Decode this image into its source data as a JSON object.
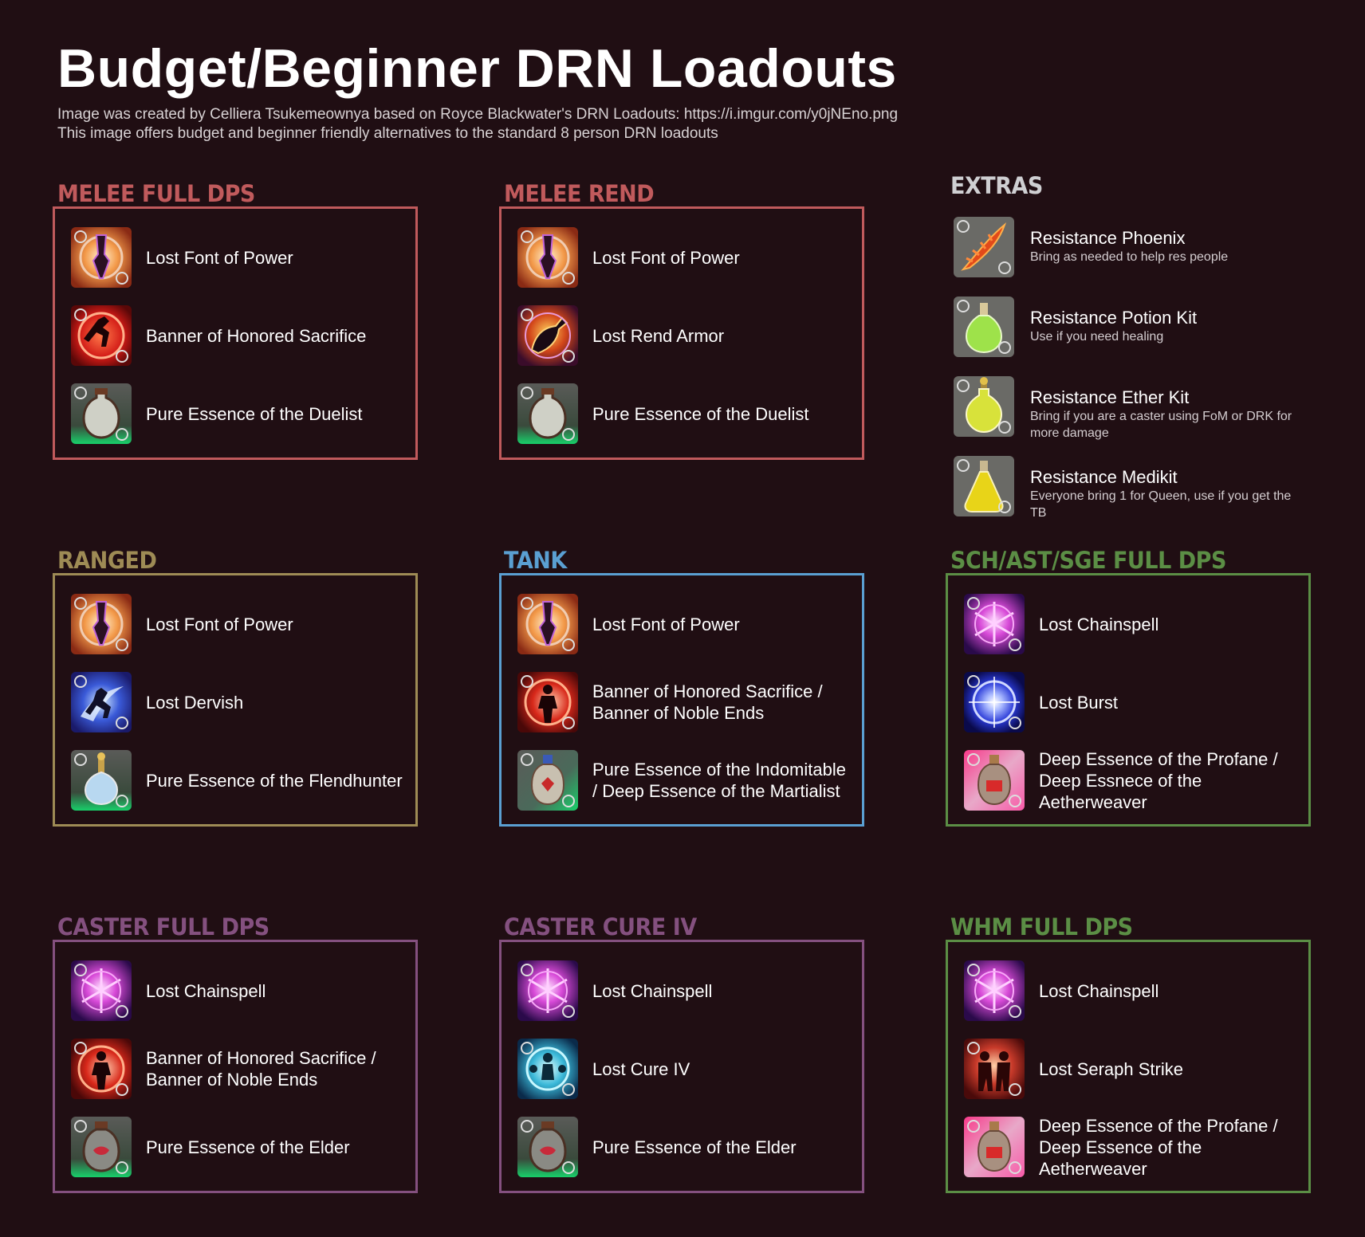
{
  "header": {
    "title": "Budget/Beginner DRN Loadouts",
    "subtitle_line1": "Image was created by Celliera Tsukemeownya based on Royce Blackwater's DRN Loadouts: https://i.imgur.com/y0jNEno.png",
    "subtitle_line2": "This image offers budget and beginner friendly alternatives to the standard 8 person DRN loadouts"
  },
  "colors": {
    "background": "#200e13",
    "melee": "#c05a5c",
    "ranged": "#9e8b55",
    "tank": "#5a9fd2",
    "healer": "#5b8e45",
    "caster": "#84507f",
    "extras": "#cfcfd2"
  },
  "sections": [
    {
      "title": "MELEE FULL DPS",
      "items": [
        {
          "label": "Lost Font of Power",
          "icon": "font-of-power-icon"
        },
        {
          "label": "Banner of Honored Sacrifice",
          "icon": "banner-honored-sacrifice-icon"
        },
        {
          "label": "Pure Essence of the Duelist",
          "icon": "essence-duelist-icon"
        }
      ]
    },
    {
      "title": "MELEE REND",
      "items": [
        {
          "label": "Lost Font of Power",
          "icon": "font-of-power-icon"
        },
        {
          "label": "Lost Rend Armor",
          "icon": "rend-armor-icon"
        },
        {
          "label": "Pure Essence of the Duelist",
          "icon": "essence-duelist-icon"
        }
      ]
    },
    {
      "title": "RANGED",
      "items": [
        {
          "label": "Lost Font of Power",
          "icon": "font-of-power-icon"
        },
        {
          "label": "Lost Dervish",
          "icon": "dervish-icon"
        },
        {
          "label": "Pure Essence of the Flendhunter",
          "icon": "essence-fiendhunter-icon"
        }
      ]
    },
    {
      "title": "TANK",
      "items": [
        {
          "label": "Lost Font of Power",
          "icon": "font-of-power-icon"
        },
        {
          "label": "Banner of Honored Sacrifice / Banner of Noble Ends",
          "icon": "banner-noble-ends-icon"
        },
        {
          "label": "Pure Essence of the Indomitable / Deep Essence of the Martialist",
          "icon": "essence-indomitable-icon"
        }
      ]
    },
    {
      "title": "SCH/AST/SGE FULL DPS",
      "items": [
        {
          "label": "Lost Chainspell",
          "icon": "chainspell-icon"
        },
        {
          "label": "Lost Burst",
          "icon": "burst-icon"
        },
        {
          "label": "Deep Essence of the Profane / Deep Essnece of the Aetherweaver",
          "icon": "essence-profane-icon"
        }
      ]
    },
    {
      "title": "CASTER FULL DPS",
      "items": [
        {
          "label": "Lost Chainspell",
          "icon": "chainspell-icon"
        },
        {
          "label": "Banner of Honored Sacrifice / Banner of Noble Ends",
          "icon": "banner-noble-ends-icon"
        },
        {
          "label": "Pure Essence of the Elder",
          "icon": "essence-elder-icon"
        }
      ]
    },
    {
      "title": "CASTER CURE IV",
      "items": [
        {
          "label": "Lost Chainspell",
          "icon": "chainspell-icon"
        },
        {
          "label": "Lost Cure IV",
          "icon": "cure-iv-icon"
        },
        {
          "label": "Pure Essence of the Elder",
          "icon": "essence-elder-icon"
        }
      ]
    },
    {
      "title": "WHM FULL DPS",
      "items": [
        {
          "label": "Lost Chainspell",
          "icon": "chainspell-icon"
        },
        {
          "label": "Lost Seraph Strike",
          "icon": "seraph-strike-icon"
        },
        {
          "label": "Deep Essence of the Profane / Deep Essence of the Aetherweaver",
          "icon": "essence-profane-icon"
        }
      ]
    }
  ],
  "extras": {
    "title": "EXTRAS",
    "items": [
      {
        "name": "Resistance Phoenix",
        "desc": "Bring as needed to help res people",
        "icon": "phoenix-feather-icon"
      },
      {
        "name": "Resistance Potion Kit",
        "desc": "Use if you need healing",
        "icon": "potion-kit-icon"
      },
      {
        "name": "Resistance Ether Kit",
        "desc": "Bring if you are a caster using FoM or DRK for more damage",
        "icon": "ether-kit-icon"
      },
      {
        "name": "Resistance Medikit",
        "desc": "Everyone bring 1 for Queen, use if you get the TB",
        "icon": "medikit-icon"
      }
    ]
  }
}
